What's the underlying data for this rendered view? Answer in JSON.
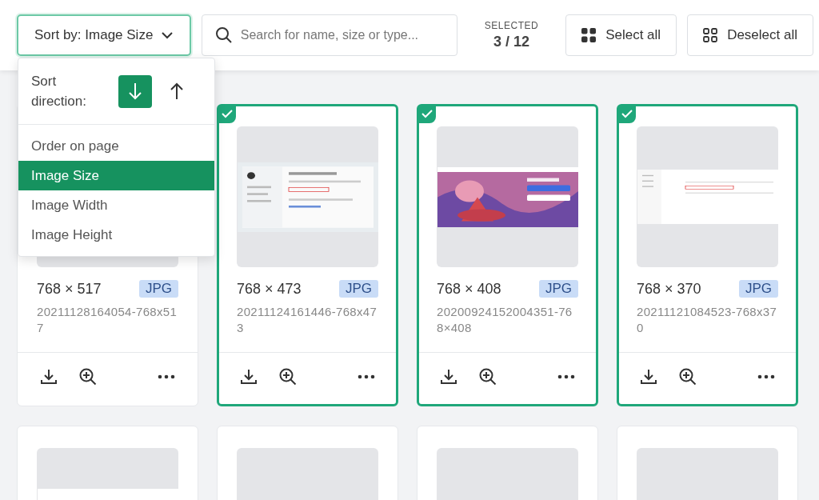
{
  "toolbar": {
    "sort_button": {
      "label": "Sort by: Image Size"
    },
    "search": {
      "placeholder": "Search for name, size or type..."
    },
    "selection": {
      "label": "SELECTED",
      "count": "3 / 12"
    },
    "buttons": [
      {
        "label": "Select all",
        "kind": "select"
      },
      {
        "label": "Deselect all",
        "kind": "deselect"
      }
    ]
  },
  "sort_menu": {
    "direction_label": "Sort direction:",
    "directions": [
      {
        "kind": "down",
        "selected": true
      },
      {
        "kind": "up",
        "selected": false
      }
    ],
    "items": [
      {
        "label": "Order on page",
        "selected": false
      },
      {
        "label": "Image Size",
        "selected": true
      },
      {
        "label": "Image Width",
        "selected": false
      },
      {
        "label": "Image Height",
        "selected": false
      }
    ]
  },
  "cards": [
    {
      "kind": "blank",
      "dims": "768 × 517",
      "format": "JPG",
      "filename": "20211128164054-768x517",
      "selected": false
    },
    {
      "kind": "picture",
      "dims": "768 × 473",
      "format": "JPG",
      "filename": "20211124161446-768x473",
      "selected": true
    },
    {
      "kind": "picture",
      "dims": "768 × 408",
      "format": "JPG",
      "filename": "20200924152004351-768×408",
      "selected": true
    },
    {
      "kind": "picture",
      "dims": "768 × 370",
      "format": "JPG",
      "filename": "20211121084523-768x370",
      "selected": true
    }
  ],
  "more_cards": [
    {
      "kind": "picture"
    },
    {
      "kind": "blank"
    },
    {
      "kind": "blank"
    },
    {
      "kind": "blank"
    }
  ]
}
